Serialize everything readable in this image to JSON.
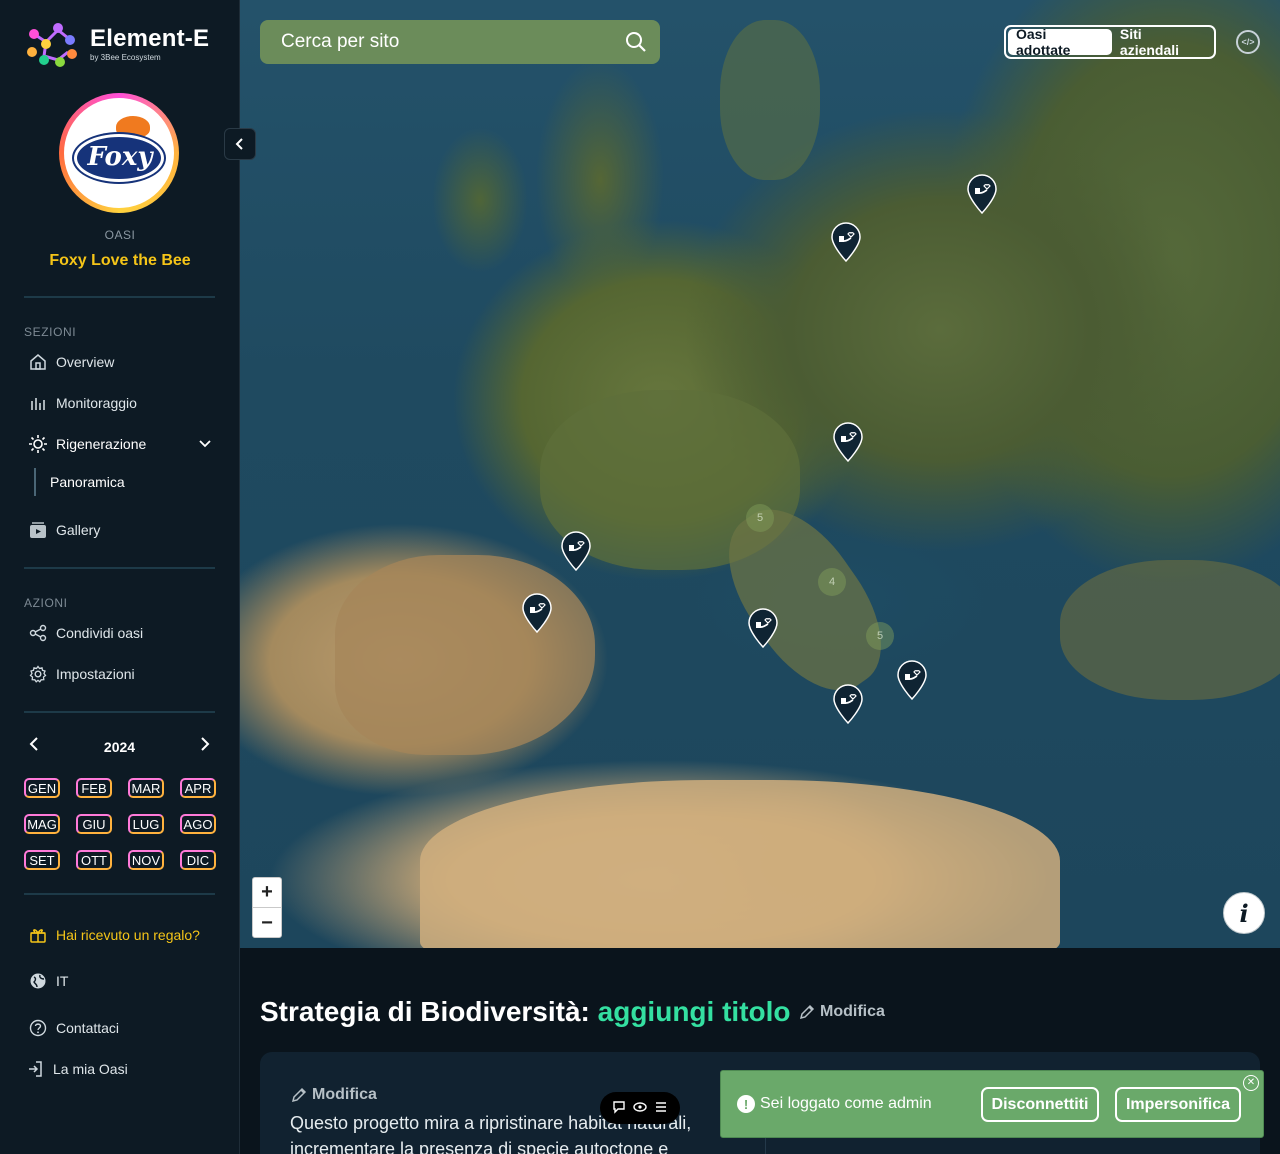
{
  "brand": {
    "name": "Element-E",
    "sub": "by 3Bee Ecosystem"
  },
  "profile": {
    "logo_text": "Foxy",
    "type_label": "OASI",
    "name": "Foxy Love the Bee"
  },
  "sections": {
    "label": "SEZIONI",
    "items": [
      {
        "label": "Overview",
        "icon": "home-icon"
      },
      {
        "label": "Monitoraggio",
        "icon": "chart-bars-icon"
      },
      {
        "label": "Rigenerazione",
        "icon": "sun-icon"
      },
      {
        "label": "Gallery",
        "icon": "gallery-icon"
      }
    ],
    "sub_item": "Panoramica"
  },
  "actions": {
    "label": "AZIONI",
    "items": [
      {
        "label": "Condividi oasi",
        "icon": "share-icon"
      },
      {
        "label": "Impostazioni",
        "icon": "gear-icon"
      }
    ]
  },
  "calendar": {
    "year": "2024",
    "months": [
      "GEN",
      "FEB",
      "MAR",
      "APR",
      "MAG",
      "GIU",
      "LUG",
      "AGO",
      "SET",
      "OTT",
      "NOV",
      "DIC"
    ]
  },
  "footer": {
    "gift": "Hai ricevuto un regalo?",
    "language": "IT",
    "contact": "Contattaci",
    "my_oasis": "La mia Oasi"
  },
  "map": {
    "search_placeholder": "Cerca per sito",
    "toggle": {
      "active": "Oasi adottate",
      "inactive": "Siti aziendali"
    },
    "clusters": [
      "5",
      "4",
      "5"
    ],
    "zoom_in": "+",
    "zoom_out": "−",
    "info": "i"
  },
  "strategy": {
    "title_prefix": "Strategia di Biodiversità:",
    "title_accent": "aggiungi titolo",
    "edit_label": "Modifica",
    "card_edit_label": "Modifica",
    "card_text": "Questo progetto mira a ripristinare habitat naturali, incrementare la presenza di specie autoctone e"
  },
  "admin_banner": {
    "message": "Sei loggato come admin",
    "disconnect": "Disconnettiti",
    "impersonate": "Impersonifica"
  },
  "colors": {
    "accent_green": "#34e0a1",
    "gold": "#f5c518",
    "banner": "#6aa96a",
    "sidebar": "#0d1a24"
  }
}
